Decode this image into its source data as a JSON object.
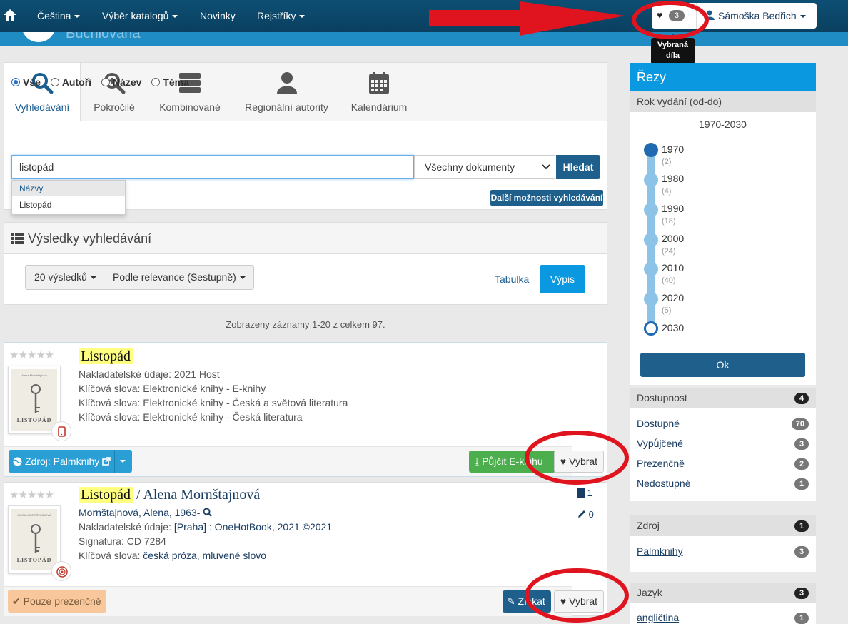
{
  "navbar": {
    "items": [
      "Čeština",
      "Výběr katalogů",
      "Novinky",
      "Rejstříky"
    ],
    "fav_count": "3",
    "user_name": "Sámoška Bedřich",
    "banner_text": "Buchlovana"
  },
  "tooltip": {
    "line1": "Vybraná",
    "line2": "díla"
  },
  "search": {
    "tabs": [
      "Vyhledávání",
      "Pokročilé",
      "Kombinované",
      "Regionální autority",
      "Kalendárium"
    ],
    "radios": [
      "Vše",
      "Autoři",
      "Název",
      "Téma"
    ],
    "query": "listopád",
    "doc_type": "Všechny dokumenty",
    "submit_label": "Hledat",
    "suggest_header": "Názvy",
    "suggest_item": "Listopád",
    "more_options": "Další možnosti vyhledávání"
  },
  "results": {
    "title": "Výsledky vyhledávání",
    "per_page": "20 výsledků",
    "sort": "Podle relevance (Sestupně)",
    "view_table": "Tabulka",
    "view_list": "Výpis",
    "summary": "Zobrazeny záznamy 1-20 z celkem 97."
  },
  "records": [
    {
      "title": "Listopád",
      "publisher_line": "Nakladatelské údaje: 2021 Host",
      "keywords": [
        "Klíčová slova: Elektronické knihy - E-knihy",
        "Klíčová slova: Elektronické knihy - Česká a světová literatura",
        "Klíčová slova: Elektronické knihy - Česká literatura"
      ],
      "cover_title": "LISTOPÁD",
      "cover_author": "Alena Mornštajnová",
      "source_label": "Zdroj: Palmknihy",
      "borrow_label": "Půjčit E-knihu",
      "select_label": "Vybrat"
    },
    {
      "title": "Listopád",
      "title_rest": "/ Alena Mornštajnová",
      "author": "Mornštajnová, Alena, 1963-",
      "publisher_prefix": "Nakladatelské údaje:",
      "publisher_value": "[Praha] : OneHotBook, 2021 ©2021",
      "signature": "Signatura: CD 7284",
      "keywords_prefix": "Klíčová slova:",
      "keywords_value": "česká próza, mluvené slovo",
      "cover_title": "LISTOPÁD",
      "cover_author": "ALENA MORNŠTAJNOVÁ",
      "stat_copies": "1",
      "stat_reviews": "0",
      "presence_label": "Pouze prezenčně",
      "get_label": "Získat",
      "select_label": "Vybrat"
    }
  ],
  "facets": {
    "title": "Řezy",
    "year_head": "Rok vydání (od-do)",
    "year_range": "1970-2030",
    "years": [
      {
        "year": "1970",
        "count": "(2)"
      },
      {
        "year": "1980",
        "count": "(4)"
      },
      {
        "year": "1990",
        "count": "(18)"
      },
      {
        "year": "2000",
        "count": "(24)"
      },
      {
        "year": "2010",
        "count": "(40)"
      },
      {
        "year": "2020",
        "count": "(5)"
      },
      {
        "year": "2030",
        "count": ""
      }
    ],
    "ok_label": "Ok",
    "availability": {
      "head": "Dostupnost",
      "count": "4",
      "items": [
        {
          "label": "Dostupné",
          "count": "70"
        },
        {
          "label": "Vypůjčené",
          "count": "3"
        },
        {
          "label": "Prezenčně",
          "count": "2"
        },
        {
          "label": "Nedostupné",
          "count": "1"
        }
      ]
    },
    "source": {
      "head": "Zdroj",
      "count": "1",
      "items": [
        {
          "label": "Palmknihy",
          "count": "3"
        }
      ]
    },
    "language": {
      "head": "Jazyk",
      "count": "3",
      "items": [
        {
          "label": "angličtina",
          "count": "1"
        }
      ]
    }
  },
  "colors": {
    "navbar": "#0c4a6e",
    "accent": "#0a98e0",
    "annotation": "#e0141e"
  }
}
